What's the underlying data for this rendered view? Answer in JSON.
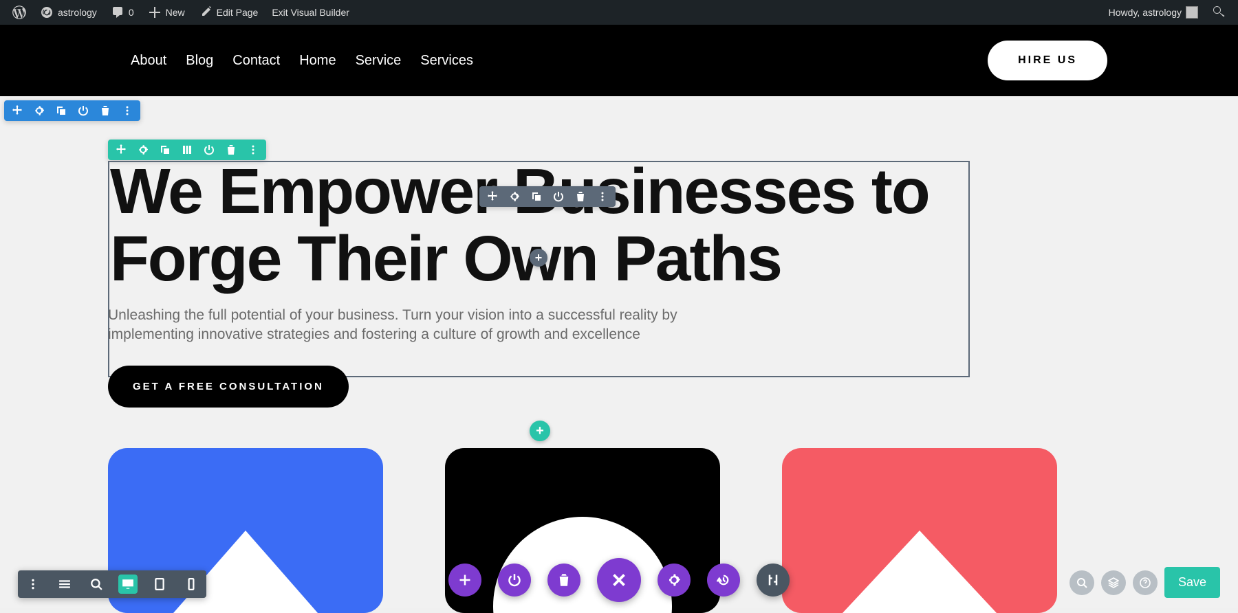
{
  "wp_bar": {
    "site_name": "astrology",
    "comments_count": "0",
    "new_label": "New",
    "edit_page": "Edit Page",
    "exit_vb": "Exit Visual Builder",
    "howdy": "Howdy, astrology"
  },
  "nav": {
    "items": [
      "About",
      "Blog",
      "Contact",
      "Home",
      "Service",
      "Services"
    ],
    "hire_label": "HIRE US"
  },
  "hero": {
    "title": "We Empower Businesses to Forge Their Own Paths",
    "subtitle": "Unleashing the full potential of your business. Turn your vision into a successful reality by implementing innovative strategies and fostering a culture of growth and excellence",
    "cta": "GET A FREE CONSULTATION"
  },
  "builder": {
    "save_label": "Save"
  }
}
